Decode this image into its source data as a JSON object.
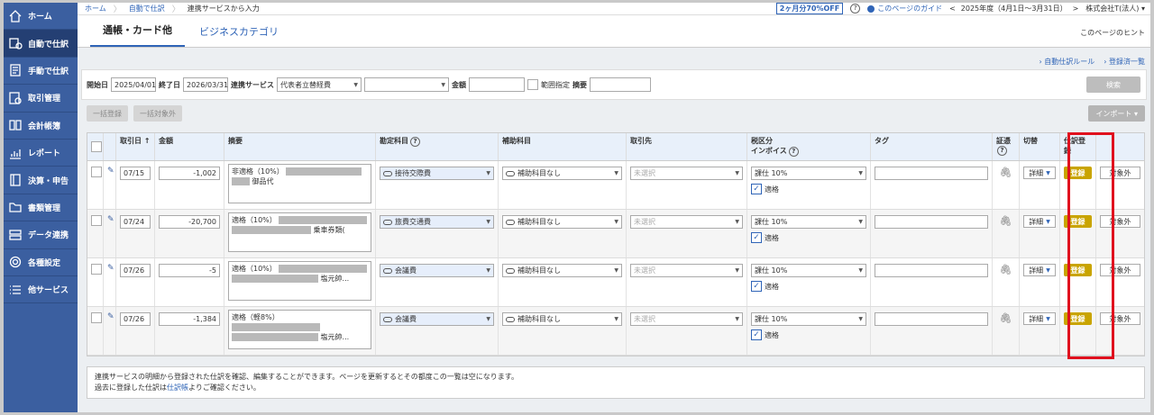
{
  "sidebar": {
    "items": [
      {
        "label": "ホーム",
        "icon": "home-icon"
      },
      {
        "label": "自動で仕訳",
        "icon": "auto-journal-icon",
        "active": true
      },
      {
        "label": "手動で仕訳",
        "icon": "manual-journal-icon"
      },
      {
        "label": "取引管理",
        "icon": "transaction-icon"
      },
      {
        "label": "会計帳簿",
        "icon": "ledger-book-icon"
      },
      {
        "label": "レポート",
        "icon": "report-chart-icon"
      },
      {
        "label": "決算・申告",
        "icon": "settlement-icon"
      },
      {
        "label": "書類管理",
        "icon": "folder-icon"
      },
      {
        "label": "データ連携",
        "icon": "data-link-icon"
      },
      {
        "label": "各種設定",
        "icon": "gear-icon"
      },
      {
        "label": "他サービス",
        "icon": "list-icon"
      }
    ]
  },
  "topbar": {
    "breadcrumbs": [
      "ホーム",
      "自動で仕訳",
      "連携サービスから入力"
    ],
    "promo": "2ヶ月分70%OFF",
    "help": "?",
    "guide": "このページのガイド",
    "fiscal_year": "2025年度（4月1日〜3月31日）",
    "company": "株式会社T(法人)",
    "prev": "<",
    "next": ">"
  },
  "tabs": [
    {
      "label": "通帳・カード他",
      "active": true
    },
    {
      "label": "ビジネスカテゴリ",
      "active": false
    }
  ],
  "hint": "このページのヒント",
  "links": {
    "auto_rule": "自動仕訳ルール",
    "registered": "登録済一覧"
  },
  "filter": {
    "start_label": "開始日",
    "start_value": "2025/04/01",
    "end_label": "終了日",
    "end_value": "2026/03/31",
    "service_label": "連携サービス",
    "service_value": "代表者立替経費",
    "amount_label": "金額",
    "range_label": "範囲指定",
    "summary_label": "摘要",
    "search_button": "検索"
  },
  "actions": {
    "bulk_register": "一括登録",
    "bulk_exclude": "一括対象外",
    "import": "インポート"
  },
  "table": {
    "headers": {
      "date": "取引日",
      "amount": "金額",
      "summary": "摘要",
      "account": "勘定科目",
      "sub_account": "補助科目",
      "partner": "取引先",
      "tax": "税区分",
      "invoice": "インボイス",
      "tag": "タグ",
      "evidence": "証憑",
      "switch": "切替",
      "register": "仕訳登録"
    },
    "rows": [
      {
        "date": "07/15",
        "amount": "-1,002",
        "desc_line1": "非適格（10%）",
        "desc_line2": "御品代",
        "account": "接待交際費",
        "sub_account": "補助科目なし",
        "partner": "未選択",
        "tax": "課仕 10%",
        "invoice": "適格",
        "detail": "詳細",
        "register": "登録",
        "exclude": "対象外"
      },
      {
        "date": "07/24",
        "amount": "-20,700",
        "desc_line1": "適格（10%）",
        "desc_line2": "乗車券類(",
        "account": "旅費交通費",
        "sub_account": "補助科目なし",
        "partner": "未選択",
        "tax": "課仕 10%",
        "invoice": "適格",
        "detail": "詳細",
        "register": "登録",
        "exclude": "対象外"
      },
      {
        "date": "07/26",
        "amount": "-5",
        "desc_line1": "適格（10%）",
        "desc_line2": "塩元帥...",
        "account": "会議費",
        "sub_account": "補助科目なし",
        "partner": "未選択",
        "tax": "課仕 10%",
        "invoice": "適格",
        "detail": "詳細",
        "register": "登録",
        "exclude": "対象外"
      },
      {
        "date": "07/26",
        "amount": "-1,384",
        "desc_line1": "適格（軽8%）",
        "desc_line2": "塩元帥...",
        "account": "会議費",
        "sub_account": "補助科目なし",
        "partner": "未選択",
        "tax": "課仕 10%",
        "invoice": "適格",
        "detail": "詳細",
        "register": "登録",
        "exclude": "対象外"
      }
    ]
  },
  "note": {
    "line1": "連携サービスの明細から登録された仕訳を確認、編集することができます。ページを更新するとその都度この一覧は空になります。",
    "line2_pre": "過去に登録した仕訳は",
    "line2_link": "仕訳帳",
    "line2_post": "よりご確認ください。"
  },
  "colors": {
    "sidebar": "#3b5fa0",
    "accent": "#2f64b7",
    "register": "#c9a400",
    "highlight": "#e0101e"
  }
}
